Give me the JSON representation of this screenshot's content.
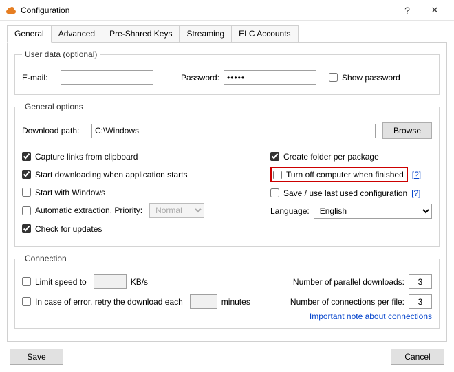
{
  "window": {
    "title": "Configuration"
  },
  "tabs": {
    "general": "General",
    "advanced": "Advanced",
    "psk": "Pre-Shared Keys",
    "streaming": "Streaming",
    "elc": "ELC Accounts"
  },
  "userdata": {
    "legend": "User data (optional)",
    "email_label": "E-mail:",
    "email_value": "",
    "password_label": "Password:",
    "password_value": "•••••",
    "show_password_label": "Show password"
  },
  "general": {
    "legend": "General options",
    "download_path_label": "Download path:",
    "download_path_value": "C:\\Windows",
    "browse_label": "Browse",
    "left": {
      "capture": "Capture links from clipboard",
      "start_dl": "Start downloading when application starts",
      "start_win": "Start with Windows",
      "auto_extract": "Automatic extraction. Priority:",
      "priority_value": "Normal",
      "check_updates": "Check for updates"
    },
    "right": {
      "create_folder": "Create folder per package",
      "turn_off": "Turn off computer when finished",
      "save_last": "Save / use last used configuration",
      "language_label": "Language:",
      "language_value": "English",
      "help_q": "[?]"
    }
  },
  "connection": {
    "legend": "Connection",
    "limit_speed": "Limit speed to",
    "limit_value": "",
    "kbs": "KB/s",
    "retry": "In case of error, retry the download each",
    "retry_value": "",
    "minutes": "minutes",
    "parallel_label": "Number of parallel downloads:",
    "parallel_value": "3",
    "perfile_label": "Number of connections per file:",
    "perfile_value": "3",
    "note_link": "Important note about connections"
  },
  "buttons": {
    "save": "Save",
    "cancel": "Cancel"
  }
}
